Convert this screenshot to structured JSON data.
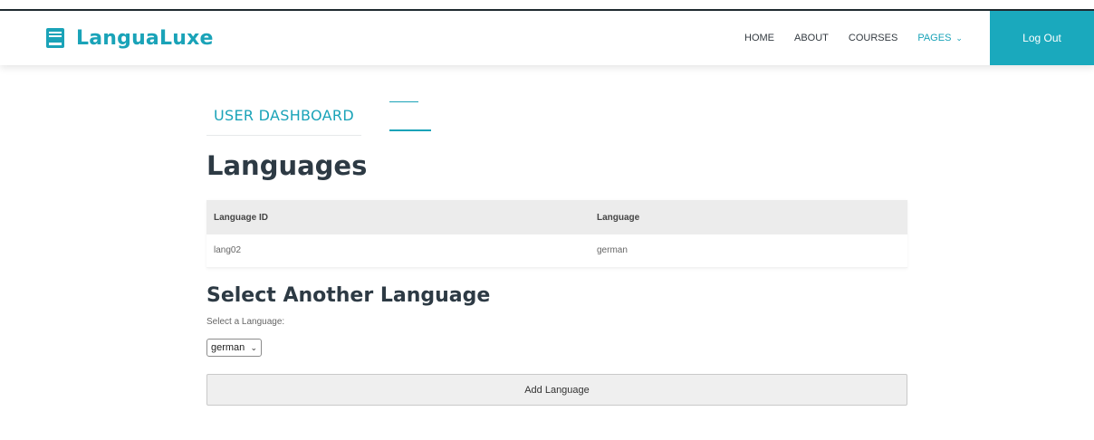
{
  "brand": {
    "name": "LanguaLuxe",
    "icon": "book-icon",
    "color": "#1aa3b8"
  },
  "nav": {
    "links": [
      "HOME",
      "ABOUT",
      "COURSES"
    ],
    "pages_label": "PAGES",
    "logout_label": "Log Out",
    "logout_color": "#1aa9bd"
  },
  "section_tag": "USER DASHBOARD",
  "page_title": "Languages",
  "table": {
    "headers": [
      "Language ID",
      "Language"
    ],
    "rows": [
      [
        "lang02",
        "german"
      ]
    ]
  },
  "select_section": {
    "title": "Select Another Language",
    "label": "Select a Language:",
    "selected": "german",
    "button_label": "Add Language"
  }
}
